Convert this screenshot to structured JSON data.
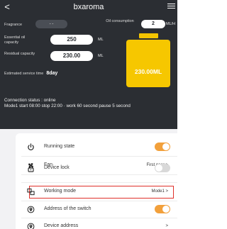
{
  "header": {
    "title": "bxaroma",
    "back_glyph": "<",
    "fragrance_label": "Fragrance",
    "fragrance_value": "- -",
    "oil_consumption_label": "Oil consumption",
    "oil_consumption_value": "2",
    "oil_consumption_unit": "ML/H",
    "essential_oil_label": "Essential oil capacity",
    "essential_oil_value": "250",
    "essential_oil_unit": "ML",
    "residual_label": "Residual capacity",
    "residual_value": "230.00",
    "residual_unit": "ML",
    "tank_display": "230.00ML",
    "estimated_label": "Estimated service time",
    "estimated_value": "8day"
  },
  "status": {
    "connection": "Connection status : online",
    "schedule": "Mode1 start 08:00 stop 22:00 · work 60 second pause 5 second"
  },
  "settings": [
    {
      "label": "Running state",
      "control": "toggle",
      "on": true,
      "icon": "power-icon"
    },
    {
      "label": "Fan",
      "value": "First gear",
      "icon": "fan-icon"
    },
    {
      "label": "Device lock",
      "control": "toggle",
      "on": false,
      "icon": "lock-icon"
    },
    {
      "label": "Working mode",
      "value": "Mode1",
      "icon": "working-mode-icon"
    },
    {
      "label": "Address of the switch",
      "control": "toggle",
      "on": true,
      "icon": "address-icon"
    },
    {
      "label": "Device address",
      "value": "",
      "icon": "device-address-icon"
    }
  ],
  "chevron": ">",
  "colors": {
    "header_bg": "#2b2e33",
    "tank": "#f6c700",
    "toggle_on": "#f2a03b",
    "toggle_off": "#d9d9d9",
    "highlight": "#e0302a"
  }
}
